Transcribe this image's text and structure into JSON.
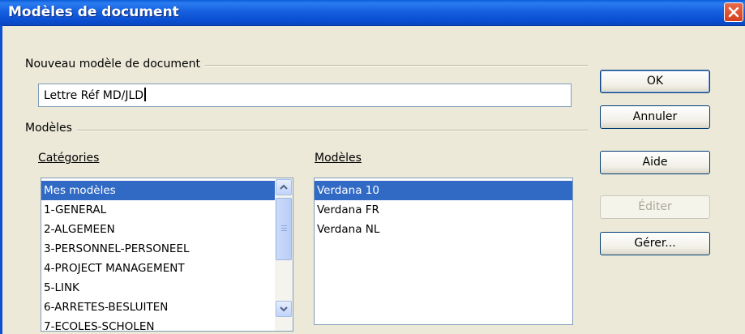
{
  "window": {
    "title": "Modèles de document"
  },
  "new_template": {
    "group_label": "Nouveau modèle de document",
    "input_value": "Lettre Réf MD/JLD"
  },
  "templates": {
    "group_label": "Modèles",
    "categories_label": "Catégories",
    "templates_label": "Modèles",
    "categories": [
      {
        "label": "Mes modèles",
        "selected": true
      },
      {
        "label": "1-GENERAL",
        "selected": false
      },
      {
        "label": "2-ALGEMEEN",
        "selected": false
      },
      {
        "label": "3-PERSONNEL-PERSONEEL",
        "selected": false
      },
      {
        "label": "4-PROJECT MANAGEMENT",
        "selected": false
      },
      {
        "label": "5-LINK",
        "selected": false
      },
      {
        "label": "6-ARRETES-BESLUITEN",
        "selected": false
      },
      {
        "label": "7-ECOLES-SCHOLEN",
        "selected": false
      }
    ],
    "template_items": [
      {
        "label": "Verdana 10",
        "selected": true
      },
      {
        "label": "Verdana FR",
        "selected": false
      },
      {
        "label": "Verdana NL",
        "selected": false
      }
    ]
  },
  "buttons": {
    "ok": "OK",
    "cancel": "Annuler",
    "help": "Aide",
    "edit": "Éditer",
    "manage": "Gérer..."
  },
  "colors": {
    "selection": "#316ac5",
    "titlebar": "#0b4fd2",
    "background": "#ece9d8"
  },
  "icons": [
    "close-icon",
    "scroll-up-icon",
    "scroll-down-icon",
    "scroll-grip-icon"
  ]
}
